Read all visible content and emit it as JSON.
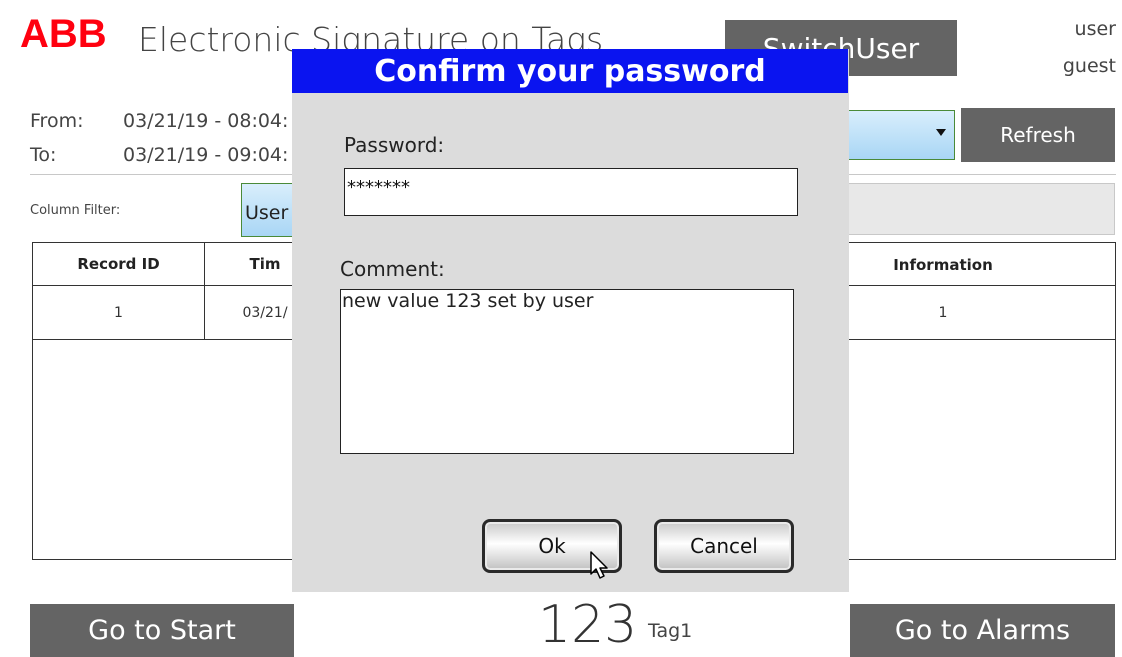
{
  "header": {
    "logo_text": "ABB",
    "title": "Electronic Signature on Tags",
    "switch_user_label": "SwitchUser",
    "user_label": "user",
    "user_value": "guest"
  },
  "range": {
    "from_label": "From:",
    "from_value": "03/21/19 - 08:04:",
    "to_label": "To:",
    "to_value": "03/21/19 - 09:04:"
  },
  "toolbar": {
    "refresh_label": "Refresh"
  },
  "filter": {
    "label": "Column Filter:",
    "selected": "User"
  },
  "table": {
    "columns": [
      "Record ID",
      "Tim",
      "Information"
    ],
    "rows": [
      [
        "1",
        "03/21/",
        "1"
      ]
    ]
  },
  "bottom": {
    "goto_start_label": "Go to Start",
    "goto_alarms_label": "Go to Alarms",
    "tag_value": "123",
    "tag_name": "Tag1"
  },
  "dialog": {
    "title": "Confirm your password",
    "password_label": "Password:",
    "password_value": "*******",
    "comment_label": "Comment:",
    "comment_value": "new value 123 set by user",
    "ok_label": "Ok",
    "cancel_label": "Cancel"
  },
  "colors": {
    "accent_button": "#646464",
    "dialog_title_bg": "#0a14f0",
    "abb_red": "#ff000f",
    "selection_blue": "#a9d6f5"
  }
}
